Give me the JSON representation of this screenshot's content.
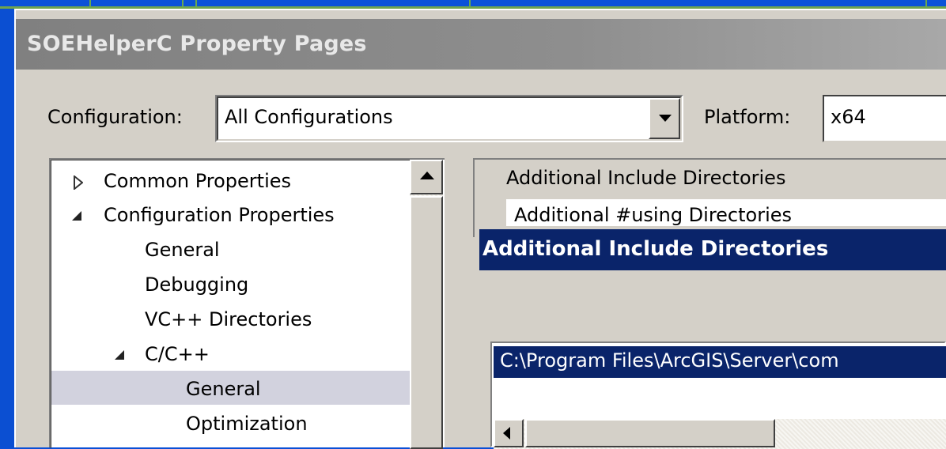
{
  "window": {
    "title": "SOEHelperC Property Pages"
  },
  "configuration": {
    "label": "Configuration:",
    "value": "All Configurations"
  },
  "platform": {
    "label": "Platform:",
    "value": "x64"
  },
  "tree": {
    "items": [
      {
        "label": "Common Properties"
      },
      {
        "label": "Configuration Properties"
      },
      {
        "label": "General"
      },
      {
        "label": "Debugging"
      },
      {
        "label": "VC++ Directories"
      },
      {
        "label": "C/C++"
      },
      {
        "label": "General"
      },
      {
        "label": "Optimization"
      }
    ],
    "selected": "General"
  },
  "property_grid": {
    "rows": [
      {
        "label": "Additional Include Directories"
      },
      {
        "label": "Additional #using Directories"
      }
    ]
  },
  "popup": {
    "title": "Additional Include Directories",
    "list": [
      "C:\\Program Files\\ArcGIS\\Server\\com"
    ]
  },
  "colors": {
    "desktop": "#0a4fd6",
    "dialog_face": "#d4d0c8",
    "active_title": "#0a246a",
    "inactive_title": "#808080",
    "tree_selection": "#d2d2de"
  }
}
